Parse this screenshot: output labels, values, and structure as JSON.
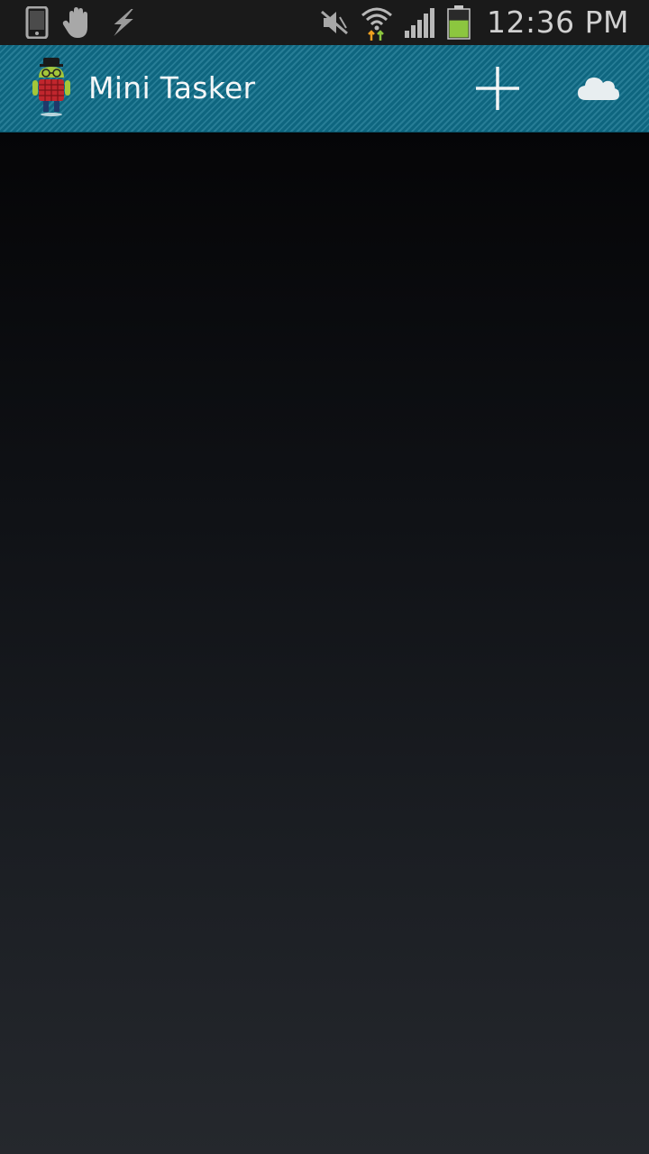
{
  "status_bar": {
    "time": "12:36 PM",
    "left_icons": [
      "phone-icon",
      "hand-icon",
      "flash-icon"
    ],
    "right_icons": [
      "mute-icon",
      "wifi-icon",
      "signal-icon",
      "battery-icon"
    ],
    "battery_color": "#8cc63f",
    "battery_level": 0.6
  },
  "action_bar": {
    "title": "Mini Tasker",
    "accent_color": "#0f6e8a",
    "actions": [
      "add-icon",
      "cloud-icon"
    ]
  },
  "content": {
    "items": []
  }
}
